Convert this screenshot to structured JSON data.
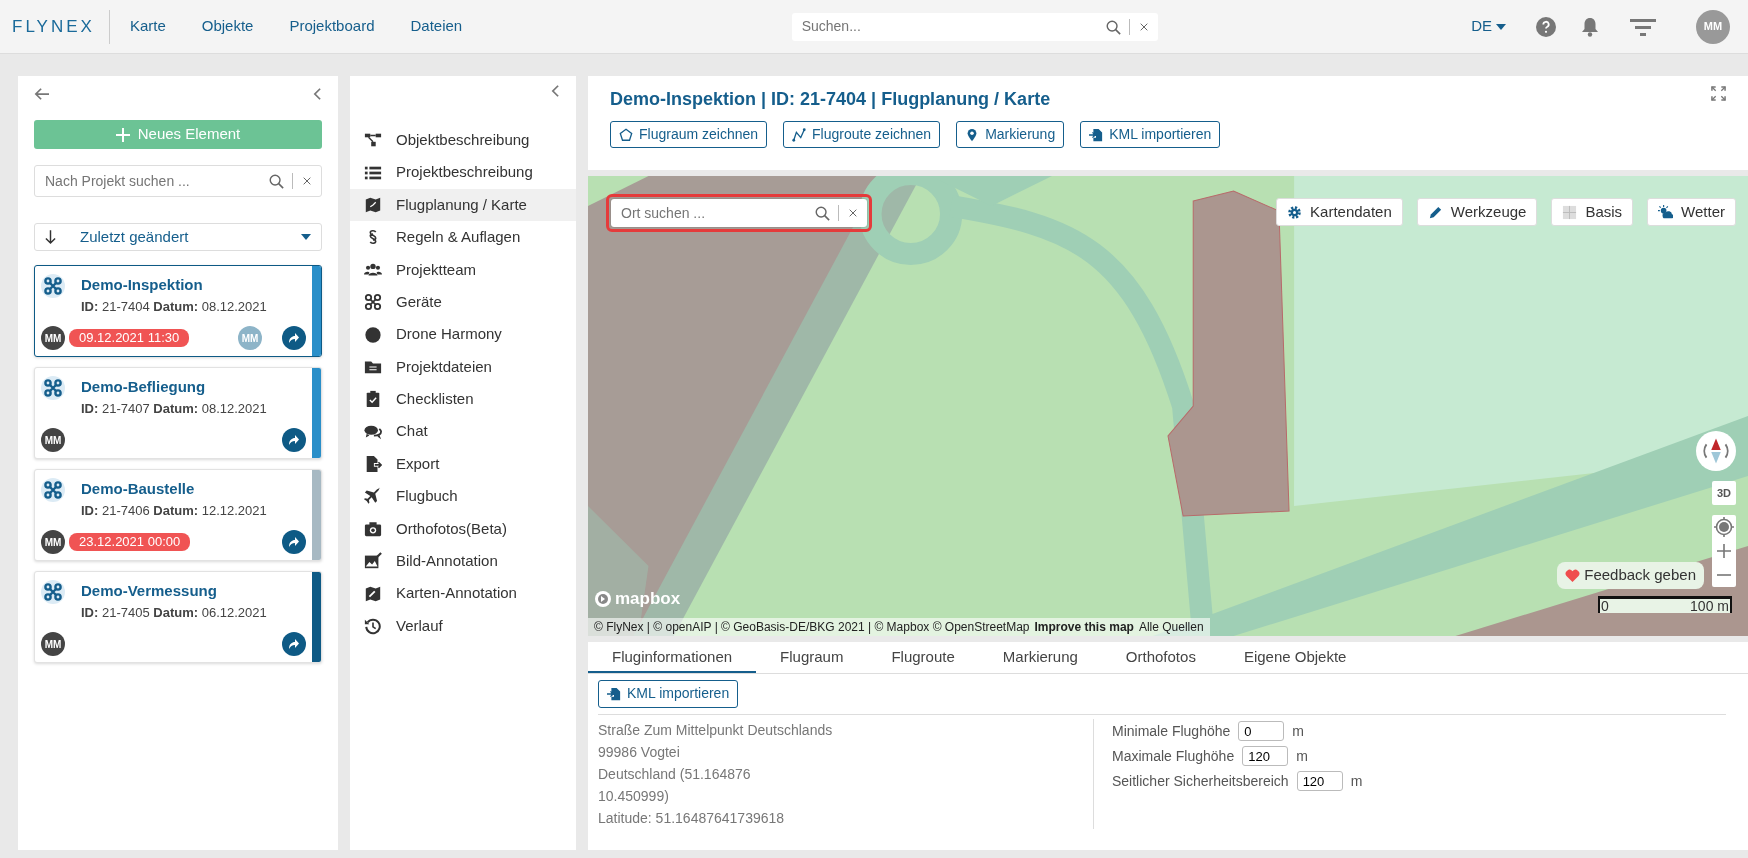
{
  "header": {
    "logo": "FLYNEX",
    "nav": [
      {
        "label": "Karte"
      },
      {
        "label": "Objekte"
      },
      {
        "label": "Projektboard"
      },
      {
        "label": "Dateien"
      }
    ],
    "search": {
      "placeholder": "Suchen..."
    },
    "language": "DE",
    "user_initials": "MM"
  },
  "project_list": {
    "new_button": "Neues Element",
    "search": {
      "placeholder": "Nach Projekt suchen ..."
    },
    "sort": "Zuletzt geändert",
    "projects": [
      {
        "title": "Demo-Inspektion",
        "meta": "**ID:** 21-7404 **Datum:** 08.12.2021",
        "owner": "MM",
        "deadline": "09.12.2021 11:30",
        "assignee": "MM",
        "selected": true,
        "color": "#2a8fc9"
      },
      {
        "title": "Demo-Befliegung",
        "meta": "**ID:** 21-7407 **Datum:** 08.12.2021",
        "owner": "MM",
        "selected": false,
        "color": "#2a8fc9"
      },
      {
        "title": "Demo-Baustelle",
        "meta": "**ID:** 21-7406 **Datum:** 12.12.2021",
        "owner": "MM",
        "deadline": "23.12.2021 00:00",
        "selected": false,
        "color": "#a7b9c3"
      },
      {
        "title": "Demo-Vermessung",
        "meta": "**ID:** 21-7405 **Datum:** 06.12.2021",
        "owner": "MM",
        "selected": false,
        "color": "#0e5a85"
      }
    ]
  },
  "menu": {
    "items": [
      {
        "label": "Objektbeschreibung",
        "selected": false
      },
      {
        "label": "Projektbeschreibung",
        "selected": false
      },
      {
        "label": "Flugplanung / Karte",
        "selected": true
      },
      {
        "label": "Regeln & Auflagen",
        "selected": false
      },
      {
        "label": "Projektteam",
        "selected": false
      },
      {
        "label": "Geräte",
        "selected": false
      },
      {
        "label": "Drone Harmony",
        "selected": false
      },
      {
        "label": "Projektdateien",
        "selected": false
      },
      {
        "label": "Checklisten",
        "selected": false
      },
      {
        "label": "Chat",
        "selected": false
      },
      {
        "label": "Export",
        "selected": false
      },
      {
        "label": "Flugbuch",
        "selected": false
      },
      {
        "label": "Orthofotos(Beta)",
        "selected": false
      },
      {
        "label": "Bild-Annotation",
        "selected": false
      },
      {
        "label": "Karten-Annotation",
        "selected": false
      },
      {
        "label": "Verlauf",
        "selected": false
      }
    ]
  },
  "content": {
    "title": "Demo-Inspektion | ID: 21-7404 | Flugplanung / Karte",
    "actions": [
      {
        "label": "Flugraum zeichnen"
      },
      {
        "label": "Flugroute zeichnen"
      },
      {
        "label": "Markierung"
      },
      {
        "label": "KML importieren"
      }
    ],
    "map": {
      "search": {
        "placeholder": "Ort suchen ...",
        "highlighted": true
      },
      "controls": [
        {
          "label": "Kartendaten"
        },
        {
          "label": "Werkzeuge"
        },
        {
          "label": "Basis"
        },
        {
          "label": "Wetter"
        }
      ],
      "three_d": "3D",
      "feedback": "Feedback geben",
      "scale": {
        "start": "0",
        "end": "100 m"
      },
      "logo": "mapbox",
      "attribution": "© FlyNex | © openAIP | © GeoBasis-DE/BKG 2021 | © Mapbox © OpenStreetMap",
      "improve_link": "Improve this map",
      "sources_link": "Alle Quellen"
    },
    "tabs": [
      {
        "label": "Fluginformationen",
        "selected": true
      },
      {
        "label": "Flugraum",
        "selected": false
      },
      {
        "label": "Flugroute",
        "selected": false
      },
      {
        "label": "Markierung",
        "selected": false
      },
      {
        "label": "Orthofotos",
        "selected": false
      },
      {
        "label": "Eigene Objekte",
        "selected": false
      }
    ],
    "import_button": "KML importieren",
    "address_lines": [
      "Straße Zum Mittelpunkt Deutschlands",
      "99986 Vogtei",
      "Deutschland (51.164876",
      "10.450999)",
      "Latitude: 51.16487641739618"
    ],
    "fields": [
      {
        "label": "Minimale Flughöhe",
        "value": "0",
        "unit": "m"
      },
      {
        "label": "Maximale Flughöhe",
        "value": "120",
        "unit": "m"
      },
      {
        "label": "Seitlicher Sicherheitsbereich",
        "value": "120",
        "unit": "m"
      }
    ]
  }
}
